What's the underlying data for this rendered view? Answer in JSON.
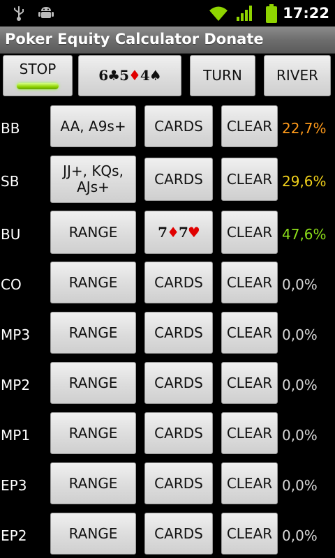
{
  "status_bar": {
    "time": "17:22",
    "icons": [
      "usb-icon",
      "android-debug-icon",
      "wifi-icon",
      "signal-icon",
      "battery-icon"
    ]
  },
  "title": "Poker Equity Calculator Donate",
  "top_controls": {
    "stop_label": "STOP",
    "board_cards": [
      {
        "rank": "6",
        "suit": "♣",
        "color": "black"
      },
      {
        "rank": "5",
        "suit": "♦",
        "color": "red"
      },
      {
        "rank": "4",
        "suit": "♠",
        "color": "black"
      }
    ],
    "turn_label": "TURN",
    "river_label": "RIVER"
  },
  "colors": {
    "equity_bb": "#ff9a1a",
    "equity_sb": "#f2d21b",
    "equity_bu": "#8ee01a",
    "equity_default": "#d8d8d8",
    "card_red": "#e00000"
  },
  "players": [
    {
      "position": "BB",
      "range": "AA, A9s+",
      "cards": "CARDS",
      "clear": "CLEAR",
      "equity": "22,7%"
    },
    {
      "position": "SB",
      "range": "JJ+, KQs, AJs+",
      "cards": "CARDS",
      "clear": "CLEAR",
      "equity": "29,6%"
    },
    {
      "position": "BU",
      "range": "RANGE",
      "cards_held": [
        {
          "rank": "7",
          "suit": "♦",
          "color": "red"
        },
        {
          "rank": "7",
          "suit": "♥",
          "color": "red"
        }
      ],
      "clear": "CLEAR",
      "equity": "47,6%"
    },
    {
      "position": "CO",
      "range": "RANGE",
      "cards": "CARDS",
      "clear": "CLEAR",
      "equity": "0,0%"
    },
    {
      "position": "MP3",
      "range": "RANGE",
      "cards": "CARDS",
      "clear": "CLEAR",
      "equity": "0,0%"
    },
    {
      "position": "MP2",
      "range": "RANGE",
      "cards": "CARDS",
      "clear": "CLEAR",
      "equity": "0,0%"
    },
    {
      "position": "MP1",
      "range": "RANGE",
      "cards": "CARDS",
      "clear": "CLEAR",
      "equity": "0,0%"
    },
    {
      "position": "EP3",
      "range": "RANGE",
      "cards": "CARDS",
      "clear": "CLEAR",
      "equity": "0,0%"
    },
    {
      "position": "EP2",
      "range": "RANGE",
      "cards": "CARDS",
      "clear": "CLEAR",
      "equity": "0,0%"
    }
  ]
}
